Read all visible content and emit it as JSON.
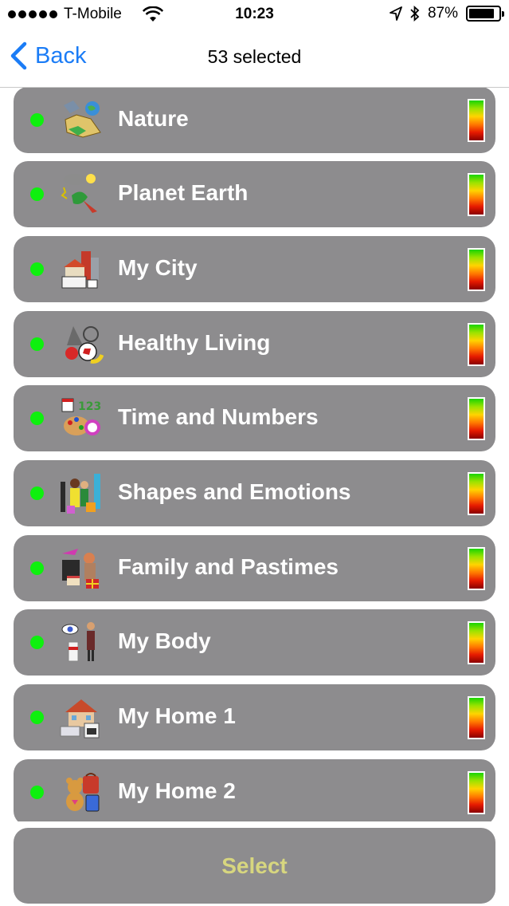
{
  "status_bar": {
    "carrier": "T-Mobile",
    "time": "10:23",
    "battery_percent": "87%",
    "battery_level": 0.87
  },
  "nav": {
    "back_label": "Back",
    "title": "53 selected",
    "accent_color": "#1b7cf6"
  },
  "list": {
    "items": [
      {
        "label": "Nature",
        "icon": "nature-icon",
        "active": true
      },
      {
        "label": "Planet Earth",
        "icon": "planet-earth-icon",
        "active": true
      },
      {
        "label": "My City",
        "icon": "my-city-icon",
        "active": true
      },
      {
        "label": "Healthy Living",
        "icon": "healthy-living-icon",
        "active": true
      },
      {
        "label": "Time and Numbers",
        "icon": "time-numbers-icon",
        "active": true
      },
      {
        "label": "Shapes and Emotions",
        "icon": "shapes-emotions-icon",
        "active": true
      },
      {
        "label": "Family and Pastimes",
        "icon": "family-pastimes-icon",
        "active": true
      },
      {
        "label": "My Body",
        "icon": "my-body-icon",
        "active": true
      },
      {
        "label": "My Home 1",
        "icon": "my-home-1-icon",
        "active": true
      },
      {
        "label": "My Home 2",
        "icon": "my-home-2-icon",
        "active": true
      }
    ],
    "row_color": "#8d8c8e",
    "active_dot_color": "#0ef00e"
  },
  "footer": {
    "select_label": "Select",
    "select_text_color": "#d7d67f"
  }
}
